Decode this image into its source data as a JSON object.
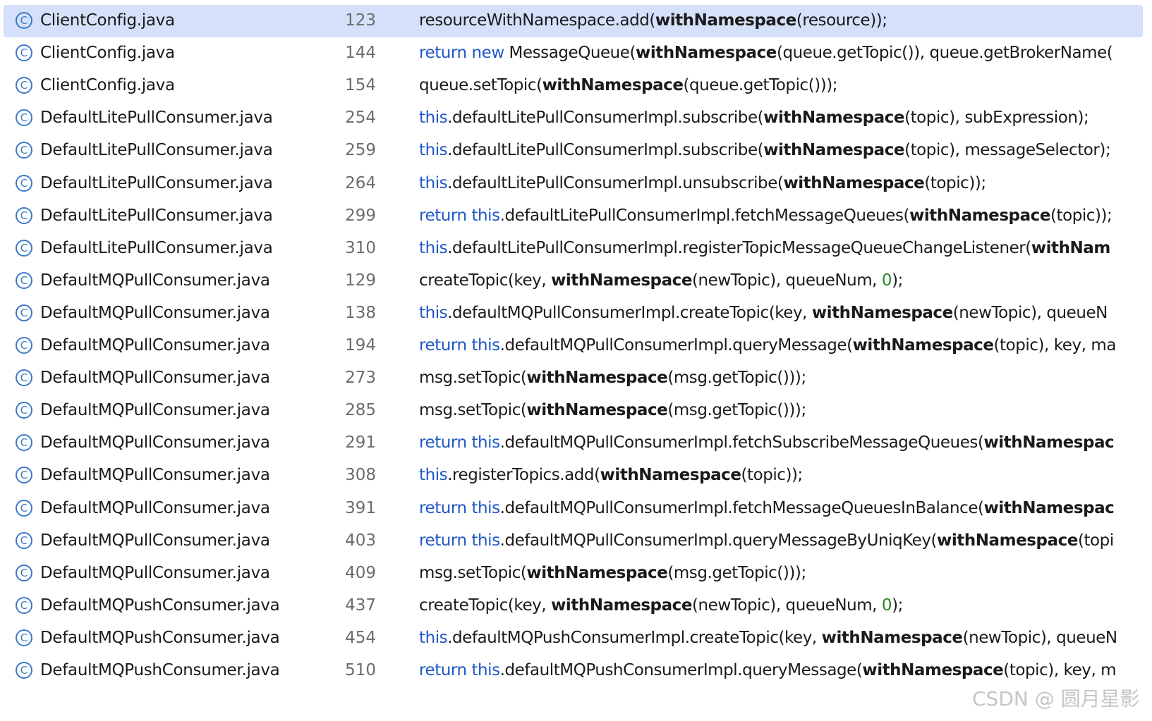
{
  "usage_results": [
    {
      "file": "ClientConfig.java",
      "line": "123",
      "selected": true,
      "code": [
        {
          "t": "resourceWithNamespace.add(",
          "k": "p"
        },
        {
          "t": "withNamespace",
          "k": "b"
        },
        {
          "t": "(resource));",
          "k": "p"
        }
      ]
    },
    {
      "file": "ClientConfig.java",
      "line": "144",
      "code": [
        {
          "t": "return new ",
          "k": "kw"
        },
        {
          "t": "MessageQueue(",
          "k": "p"
        },
        {
          "t": "withNamespace",
          "k": "b"
        },
        {
          "t": "(queue.getTopic()), queue.getBrokerName(",
          "k": "p"
        }
      ]
    },
    {
      "file": "ClientConfig.java",
      "line": "154",
      "code": [
        {
          "t": "queue.setTopic(",
          "k": "p"
        },
        {
          "t": "withNamespace",
          "k": "b"
        },
        {
          "t": "(queue.getTopic()));",
          "k": "p"
        }
      ]
    },
    {
      "file": "DefaultLitePullConsumer.java",
      "line": "254",
      "code": [
        {
          "t": "this",
          "k": "kw"
        },
        {
          "t": ".defaultLitePullConsumerImpl.subscribe(",
          "k": "p"
        },
        {
          "t": "withNamespace",
          "k": "b"
        },
        {
          "t": "(topic), subExpression);",
          "k": "p"
        }
      ]
    },
    {
      "file": "DefaultLitePullConsumer.java",
      "line": "259",
      "code": [
        {
          "t": "this",
          "k": "kw"
        },
        {
          "t": ".defaultLitePullConsumerImpl.subscribe(",
          "k": "p"
        },
        {
          "t": "withNamespace",
          "k": "b"
        },
        {
          "t": "(topic), messageSelector);",
          "k": "p"
        }
      ]
    },
    {
      "file": "DefaultLitePullConsumer.java",
      "line": "264",
      "code": [
        {
          "t": "this",
          "k": "kw"
        },
        {
          "t": ".defaultLitePullConsumerImpl.unsubscribe(",
          "k": "p"
        },
        {
          "t": "withNamespace",
          "k": "b"
        },
        {
          "t": "(topic));",
          "k": "p"
        }
      ]
    },
    {
      "file": "DefaultLitePullConsumer.java",
      "line": "299",
      "code": [
        {
          "t": "return this",
          "k": "kw"
        },
        {
          "t": ".defaultLitePullConsumerImpl.fetchMessageQueues(",
          "k": "p"
        },
        {
          "t": "withNamespace",
          "k": "b"
        },
        {
          "t": "(topic));",
          "k": "p"
        }
      ]
    },
    {
      "file": "DefaultLitePullConsumer.java",
      "line": "310",
      "code": [
        {
          "t": "this",
          "k": "kw"
        },
        {
          "t": ".defaultLitePullConsumerImpl.registerTopicMessageQueueChangeListener(",
          "k": "p"
        },
        {
          "t": "withNam",
          "k": "b"
        }
      ]
    },
    {
      "file": "DefaultMQPullConsumer.java",
      "line": "129",
      "code": [
        {
          "t": "createTopic(key, ",
          "k": "p"
        },
        {
          "t": "withNamespace",
          "k": "b"
        },
        {
          "t": "(newTopic), queueNum, ",
          "k": "p"
        },
        {
          "t": "0",
          "k": "num"
        },
        {
          "t": ");",
          "k": "p"
        }
      ]
    },
    {
      "file": "DefaultMQPullConsumer.java",
      "line": "138",
      "code": [
        {
          "t": "this",
          "k": "kw"
        },
        {
          "t": ".defaultMQPullConsumerImpl.createTopic(key, ",
          "k": "p"
        },
        {
          "t": "withNamespace",
          "k": "b"
        },
        {
          "t": "(newTopic), queueN",
          "k": "p"
        }
      ]
    },
    {
      "file": "DefaultMQPullConsumer.java",
      "line": "194",
      "code": [
        {
          "t": "return this",
          "k": "kw"
        },
        {
          "t": ".defaultMQPullConsumerImpl.queryMessage(",
          "k": "p"
        },
        {
          "t": "withNamespace",
          "k": "b"
        },
        {
          "t": "(topic), key, ma",
          "k": "p"
        }
      ]
    },
    {
      "file": "DefaultMQPullConsumer.java",
      "line": "273",
      "code": [
        {
          "t": "msg.setTopic(",
          "k": "p"
        },
        {
          "t": "withNamespace",
          "k": "b"
        },
        {
          "t": "(msg.getTopic()));",
          "k": "p"
        }
      ]
    },
    {
      "file": "DefaultMQPullConsumer.java",
      "line": "285",
      "code": [
        {
          "t": "msg.setTopic(",
          "k": "p"
        },
        {
          "t": "withNamespace",
          "k": "b"
        },
        {
          "t": "(msg.getTopic()));",
          "k": "p"
        }
      ]
    },
    {
      "file": "DefaultMQPullConsumer.java",
      "line": "291",
      "code": [
        {
          "t": "return this",
          "k": "kw"
        },
        {
          "t": ".defaultMQPullConsumerImpl.fetchSubscribeMessageQueues(",
          "k": "p"
        },
        {
          "t": "withNamespac",
          "k": "b"
        }
      ]
    },
    {
      "file": "DefaultMQPullConsumer.java",
      "line": "308",
      "code": [
        {
          "t": "this",
          "k": "kw"
        },
        {
          "t": ".registerTopics.add(",
          "k": "p"
        },
        {
          "t": "withNamespace",
          "k": "b"
        },
        {
          "t": "(topic));",
          "k": "p"
        }
      ]
    },
    {
      "file": "DefaultMQPullConsumer.java",
      "line": "391",
      "code": [
        {
          "t": "return this",
          "k": "kw"
        },
        {
          "t": ".defaultMQPullConsumerImpl.fetchMessageQueuesInBalance(",
          "k": "p"
        },
        {
          "t": "withNamespac",
          "k": "b"
        }
      ]
    },
    {
      "file": "DefaultMQPullConsumer.java",
      "line": "403",
      "code": [
        {
          "t": "return this",
          "k": "kw"
        },
        {
          "t": ".defaultMQPullConsumerImpl.queryMessageByUniqKey(",
          "k": "p"
        },
        {
          "t": "withNamespace",
          "k": "b"
        },
        {
          "t": "(topi",
          "k": "p"
        }
      ]
    },
    {
      "file": "DefaultMQPullConsumer.java",
      "line": "409",
      "code": [
        {
          "t": "msg.setTopic(",
          "k": "p"
        },
        {
          "t": "withNamespace",
          "k": "b"
        },
        {
          "t": "(msg.getTopic()));",
          "k": "p"
        }
      ]
    },
    {
      "file": "DefaultMQPushConsumer.java",
      "line": "437",
      "code": [
        {
          "t": "createTopic(key, ",
          "k": "p"
        },
        {
          "t": "withNamespace",
          "k": "b"
        },
        {
          "t": "(newTopic), queueNum, ",
          "k": "p"
        },
        {
          "t": "0",
          "k": "num"
        },
        {
          "t": ");",
          "k": "p"
        }
      ]
    },
    {
      "file": "DefaultMQPushConsumer.java",
      "line": "454",
      "code": [
        {
          "t": "this",
          "k": "kw"
        },
        {
          "t": ".defaultMQPushConsumerImpl.createTopic(key, ",
          "k": "p"
        },
        {
          "t": "withNamespace",
          "k": "b"
        },
        {
          "t": "(newTopic), queueN",
          "k": "p"
        }
      ]
    },
    {
      "file": "DefaultMQPushConsumer.java",
      "line": "510",
      "code": [
        {
          "t": "return this",
          "k": "kw"
        },
        {
          "t": ".defaultMQPushConsumerImpl.queryMessage(",
          "k": "p"
        },
        {
          "t": "withNamespace",
          "k": "b"
        },
        {
          "t": "(topic), key, m",
          "k": "p"
        }
      ]
    }
  ],
  "class_icon_glyph": "C",
  "colors": {
    "keyword": "#1f57c6",
    "number": "#27872a",
    "selection": "#d5e1fa",
    "class_icon": "#3d7ac8"
  },
  "icon": "java-class-icon",
  "watermark": "CSDN @ 圆月星影"
}
